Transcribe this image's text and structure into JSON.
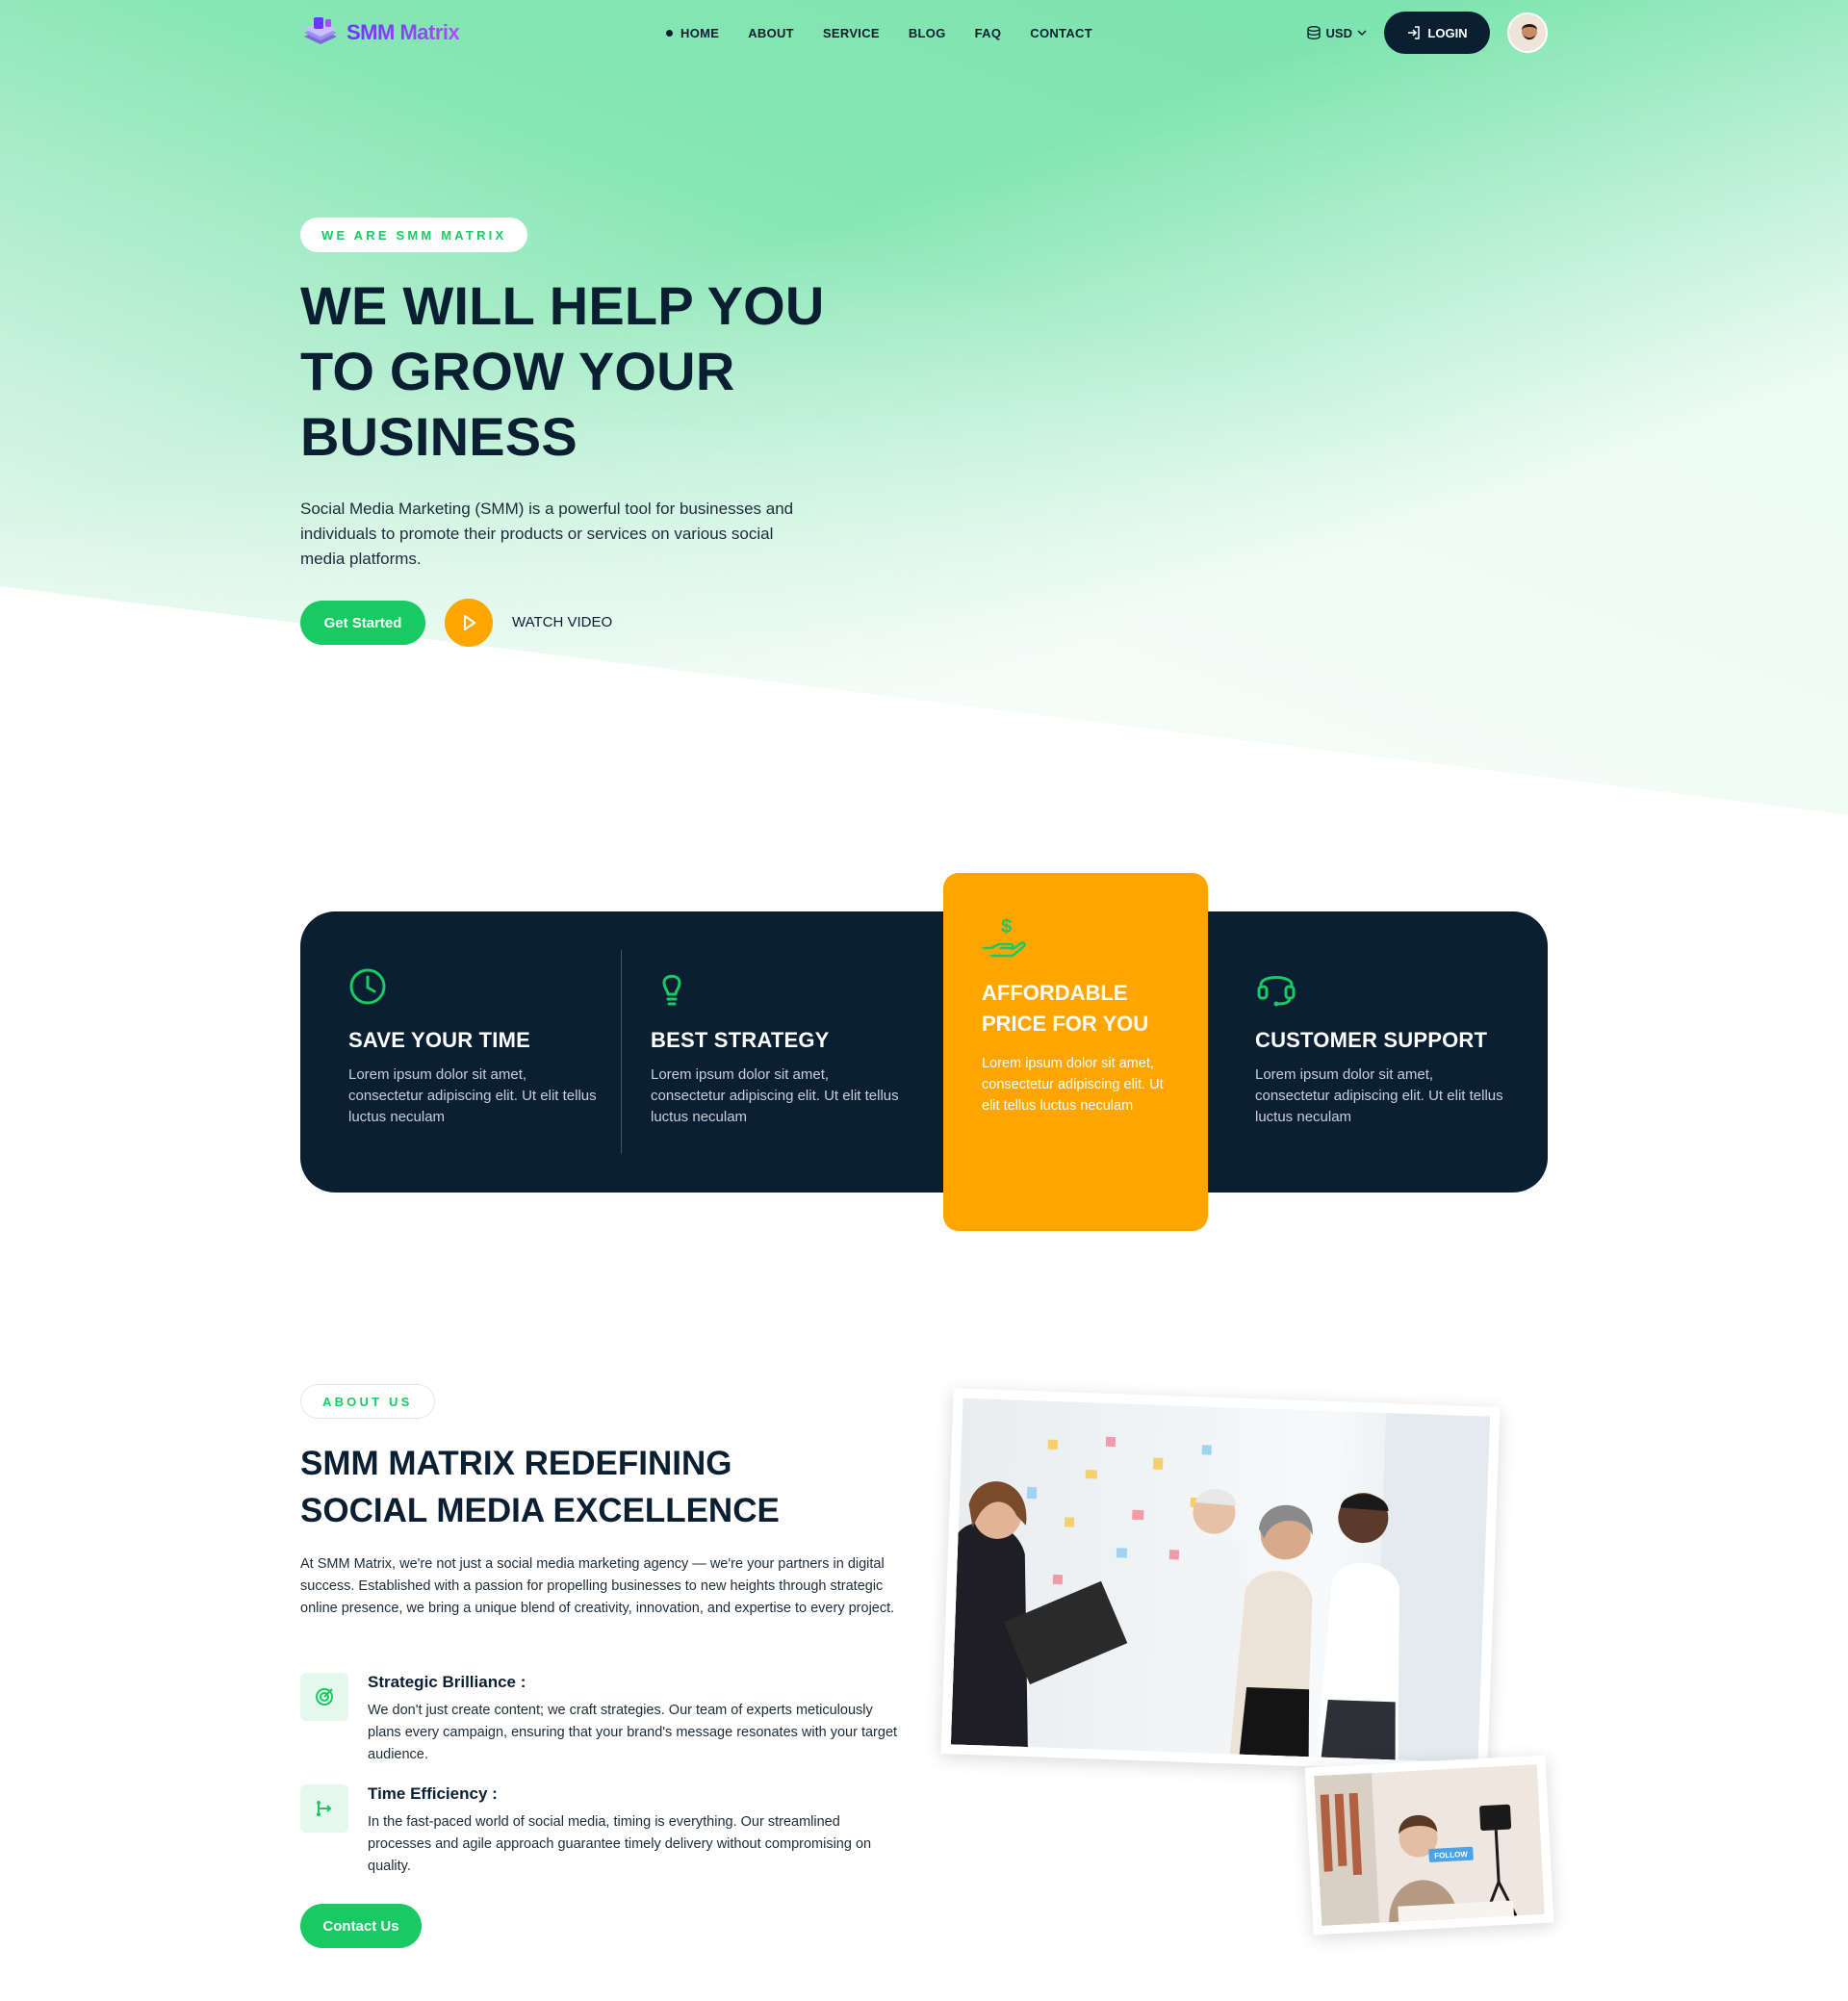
{
  "colors": {
    "brand_green": "#18c964",
    "navy": "#0b1f33",
    "orange": "#ffa500",
    "logo_purple": "#7b3dff"
  },
  "header": {
    "logo_text": "SMM Matrix",
    "nav": [
      "HOME",
      "ABOUT",
      "SERVICE",
      "BLOG",
      "FAQ",
      "CONTACT"
    ],
    "active_nav": "HOME",
    "currency": "USD",
    "login_label": "LOGIN"
  },
  "hero": {
    "tag": "WE ARE SMM MATRIX",
    "title_lines": [
      "WE WILL HELP YOU",
      "TO GROW YOUR",
      "BUSINESS"
    ],
    "description": "Social Media Marketing (SMM) is a powerful tool for businesses and individuals to promote their products or services on various social media platforms.",
    "cta_label": "Get Started",
    "video_label": "WATCH VIDEO"
  },
  "features": [
    {
      "icon": "clock-icon",
      "title": "SAVE YOUR TIME",
      "text": "Lorem ipsum dolor sit amet, consectetur adipiscing elit. Ut elit tellus luctus neculam"
    },
    {
      "icon": "lightbulb-icon",
      "title": "BEST STRATEGY",
      "text": "Lorem ipsum dolor sit amet, consectetur adipiscing elit. Ut elit tellus luctus neculam"
    },
    {
      "icon": "hand-dollar-icon",
      "title_lines": [
        "AFFORDABLE",
        "PRICE FOR YOU"
      ],
      "text": "Lorem ipsum dolor sit amet, consectetur adipiscing elit. Ut elit tellus luctus neculam",
      "highlighted": true
    },
    {
      "icon": "headset-icon",
      "title": "CUSTOMER SUPPORT",
      "text": "Lorem ipsum dolor sit amet, consectetur adipiscing elit. Ut elit tellus luctus neculam"
    }
  ],
  "about": {
    "tag": "ABOUT US",
    "title_lines": [
      "SMM MATRIX REDEFINING",
      "SOCIAL MEDIA EXCELLENCE"
    ],
    "description": "At SMM Matrix, we're not just a social media marketing agency — we're your partners in digital success. Established with a passion for propelling businesses to new heights through strategic online presence, we bring a unique blend of creativity, innovation, and expertise to every project.",
    "points": [
      {
        "icon": "target-icon",
        "title": "Strategic Brilliance :",
        "text": "We don't just create content; we craft strategies. Our team of experts meticulously plans every campaign, ensuring that your brand's message resonates with your target audience."
      },
      {
        "icon": "flow-icon",
        "title": "Time Efficiency :",
        "text": "In the fast-paced world of social media, timing is everything. Our streamlined processes and agile approach guarantee timely delivery without compromising on quality."
      }
    ],
    "cta_label": "Contact Us",
    "small_photo_badge": "FOLLOW"
  }
}
